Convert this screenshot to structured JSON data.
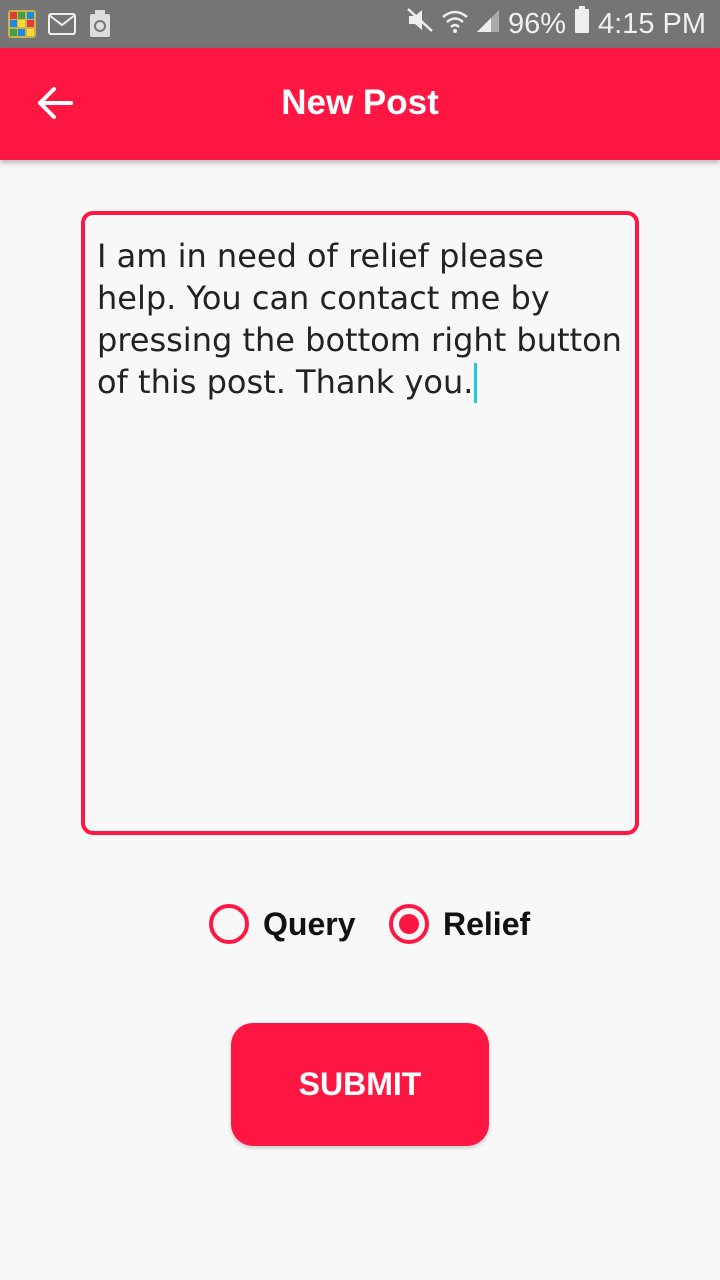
{
  "status_bar": {
    "battery": "96%",
    "time": "4:15 PM",
    "icons_left": [
      "app-grid-icon",
      "mail-icon",
      "recycle-icon"
    ],
    "icons_right": [
      "mute-icon",
      "wifi-icon",
      "signal-icon",
      "battery-icon"
    ]
  },
  "app_bar": {
    "title": "New Post",
    "back_icon": "arrow-back-icon",
    "color": "#ff1744"
  },
  "post": {
    "text": "I am in need of relief please help. You can contact me by pressing the bottom right button of this post. Thank you."
  },
  "post_type": {
    "options": [
      {
        "label": "Query",
        "selected": false
      },
      {
        "label": "Relief",
        "selected": true
      }
    ]
  },
  "submit": {
    "label": "SUBMIT"
  }
}
